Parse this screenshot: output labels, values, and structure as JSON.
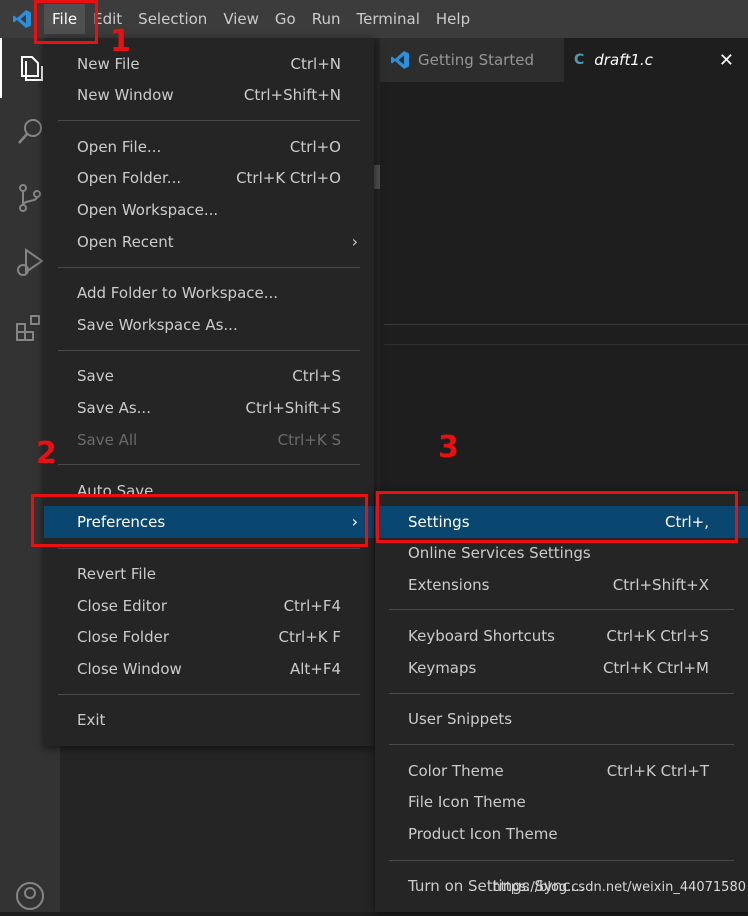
{
  "menubar": {
    "items": [
      "File",
      "Edit",
      "Selection",
      "View",
      "Go",
      "Run",
      "Terminal",
      "Help"
    ]
  },
  "tabs": [
    {
      "label": "Getting Started"
    },
    {
      "label": "draft1.c",
      "lang_badge": "C",
      "close": "✕"
    }
  ],
  "file_menu": {
    "items": [
      {
        "label": "New File",
        "key": "Ctrl+N"
      },
      {
        "label": "New Window",
        "key": "Ctrl+Shift+N"
      },
      {
        "label": "Open File...",
        "key": "Ctrl+O"
      },
      {
        "label": "Open Folder...",
        "key": "Ctrl+K Ctrl+O"
      },
      {
        "label": "Open Workspace...",
        "key": ""
      },
      {
        "label": "Open Recent",
        "key": ""
      },
      {
        "label": "Add Folder to Workspace...",
        "key": ""
      },
      {
        "label": "Save Workspace As...",
        "key": ""
      },
      {
        "label": "Save",
        "key": "Ctrl+S"
      },
      {
        "label": "Save As...",
        "key": "Ctrl+Shift+S"
      },
      {
        "label": "Save All",
        "key": "Ctrl+K S"
      },
      {
        "label": "Auto Save",
        "key": ""
      },
      {
        "label": "Preferences",
        "key": ""
      },
      {
        "label": "Revert File",
        "key": ""
      },
      {
        "label": "Close Editor",
        "key": "Ctrl+F4"
      },
      {
        "label": "Close Folder",
        "key": "Ctrl+K F"
      },
      {
        "label": "Close Window",
        "key": "Alt+F4"
      },
      {
        "label": "Exit",
        "key": ""
      }
    ],
    "submenu_arrow": "›"
  },
  "pref_menu": {
    "items": [
      {
        "label": "Settings",
        "key": "Ctrl+,"
      },
      {
        "label": "Online Services Settings",
        "key": ""
      },
      {
        "label": "Extensions",
        "key": "Ctrl+Shift+X"
      },
      {
        "label": "Keyboard Shortcuts",
        "key": "Ctrl+K Ctrl+S"
      },
      {
        "label": "Keymaps",
        "key": "Ctrl+K Ctrl+M"
      },
      {
        "label": "User Snippets",
        "key": ""
      },
      {
        "label": "Color Theme",
        "key": "Ctrl+K Ctrl+T"
      },
      {
        "label": "File Icon Theme",
        "key": ""
      },
      {
        "label": "Product Icon Theme",
        "key": ""
      },
      {
        "label": "Turn on Settings Sync...",
        "key": ""
      }
    ]
  },
  "annotations": {
    "step1": "1",
    "step2": "2",
    "step3": "3",
    "highlight_color": "#e81010"
  },
  "watermark": "https://blog.csdn.net/weixin_44071580",
  "colors": {
    "menubar": "#3c3c3c",
    "activitybar": "#333333",
    "menu_bg": "#252526",
    "selection": "#094771",
    "vscode_blue": "#2c8fdb"
  },
  "icons": [
    "vscode-logo-icon",
    "explorer-icon",
    "search-icon",
    "source-control-icon",
    "run-debug-icon",
    "extensions-icon",
    "account-icon"
  ]
}
